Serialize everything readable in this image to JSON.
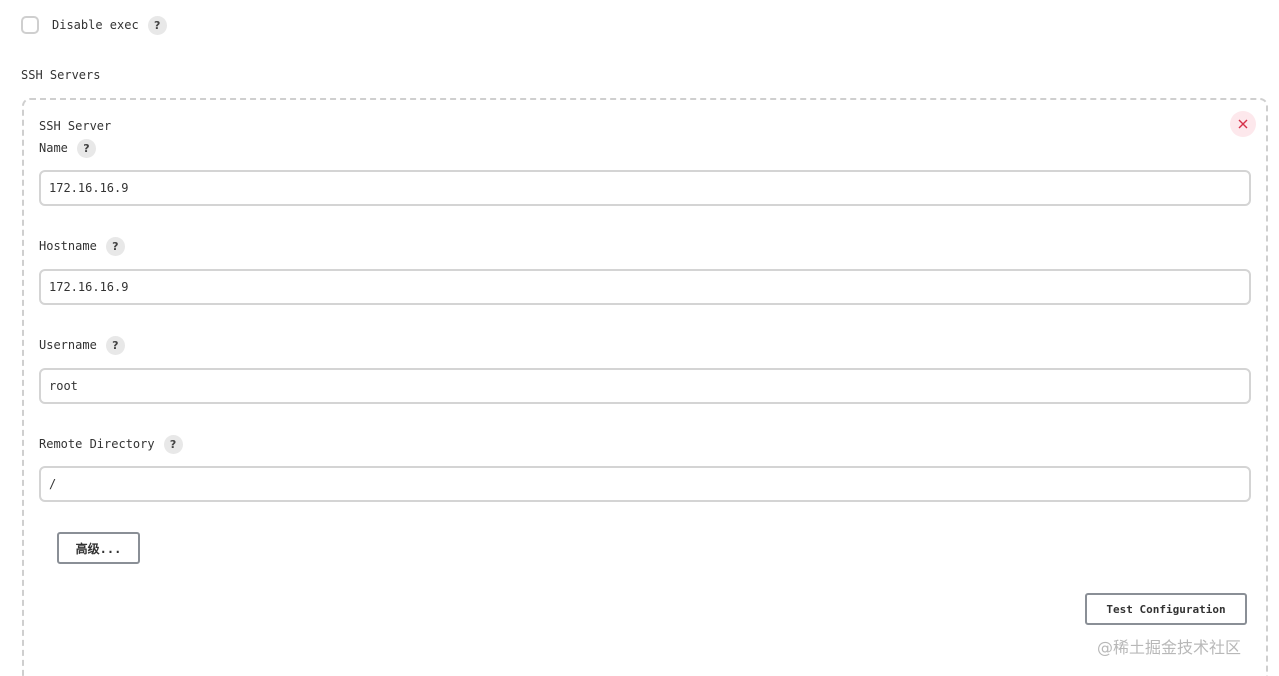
{
  "disable_exec": {
    "label": "Disable exec",
    "checked": false,
    "help_icon": "?"
  },
  "ssh_servers": {
    "section_label": "SSH Servers",
    "server": {
      "title": "SSH Server",
      "delete_icon": "close-icon",
      "fields": {
        "name": {
          "label": "Name",
          "value": "172.16.16.9",
          "help_icon": "?"
        },
        "hostname": {
          "label": "Hostname",
          "value": "172.16.16.9",
          "help_icon": "?"
        },
        "username": {
          "label": "Username",
          "value": "root",
          "help_icon": "?"
        },
        "remote_directory": {
          "label": "Remote Directory",
          "value": "/",
          "help_icon": "?"
        }
      },
      "advanced_button": "高级...",
      "test_button": "Test Configuration"
    }
  },
  "watermark": "@稀土掘金技术社区",
  "colors": {
    "delete_bg": "#fde8ec",
    "delete_icon": "#d6324a",
    "border": "#cfcfcf"
  }
}
